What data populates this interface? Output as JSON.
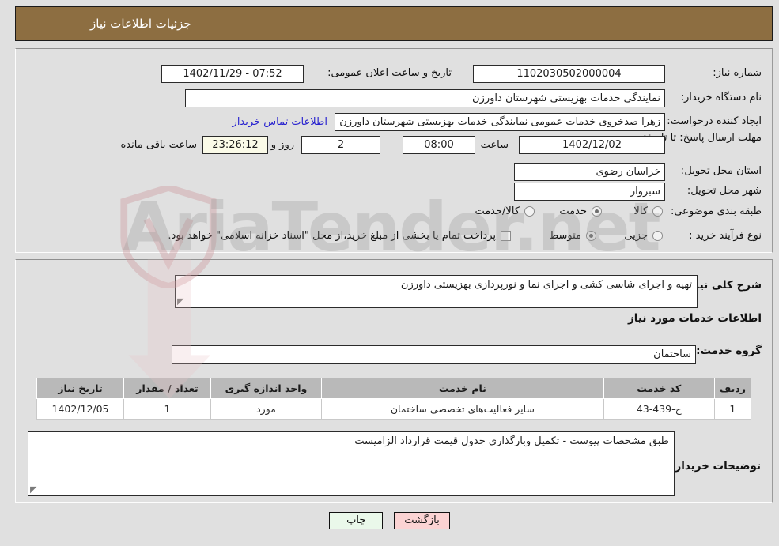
{
  "header": {
    "title": "جزئیات اطلاعات نیاز",
    "bar_color": "#8d6e41"
  },
  "top_form": {
    "need_number_label": "شماره نیاز:",
    "need_number_value": "1102030502000004",
    "public_announce_label": "تاریخ و ساعت اعلان عمومی:",
    "public_announce_value": "07:52 - 1402/11/29",
    "buyer_org_label": "نام دستگاه خریدار:",
    "buyer_org_value": "نمایندگی خدمات بهزیستی شهرستان داورزن",
    "creator_label": "ایجاد کننده درخواست:",
    "creator_value": "زهرا صدخروی خدمات عمومی نمایندگی خدمات بهزیستی شهرستان داورزن",
    "contact_link": "اطلاعات تماس خریدار",
    "deadline_label": "مهلت ارسال پاسخ: تا تاریخ:",
    "deadline_date": "1402/12/02",
    "hour_label": "ساعت",
    "hour_value": "08:00",
    "days_value": "2",
    "days_label": "روز و",
    "countdown_value": "23:26:12",
    "countdown_label": "ساعت باقی مانده",
    "province_label": "استان محل تحویل:",
    "province_value": "خراسان رضوی",
    "city_label": "شهر محل تحویل:",
    "city_value": "سبزوار",
    "category_label": "طبقه بندی موضوعی:",
    "category_options": [
      {
        "label": "کالا",
        "selected": false
      },
      {
        "label": "خدمت",
        "selected": true
      },
      {
        "label": "کالا/خدمت",
        "selected": false
      }
    ],
    "purchase_type_label": "نوع فرآیند خرید :",
    "purchase_type_options": [
      {
        "label": "جزیی",
        "selected": false
      },
      {
        "label": "متوسط",
        "selected": true
      }
    ],
    "islamic_treasury_note": "پرداخت تمام یا بخشی از مبلغ خرید،از محل \"اسناد خزانه اسلامی\" خواهد بود."
  },
  "general": {
    "desc_label": "شرح کلی نیاز:",
    "desc_value": "تهیه و اجرای شاسی کشی و اجرای نما و نورپردازی بهزیستی داورزن",
    "services_section_title": "اطلاعات خدمات مورد نیاز",
    "service_group_label": "گروه خدمت:",
    "service_group_value": "ساختمان"
  },
  "table": {
    "columns": [
      "ردیف",
      "کد خدمت",
      "نام خدمت",
      "واحد اندازه گیری",
      "تعداد / مقدار",
      "تاریخ نیاز"
    ],
    "rows": [
      {
        "index": "1",
        "code": "ج-439-43",
        "name": "سایر فعالیت‌های تخصصی ساختمان",
        "unit": "مورد",
        "qty": "1",
        "date": "1402/12/05"
      }
    ]
  },
  "buyer_notes": {
    "label": "توضیحات خریدار:",
    "value": "طبق مشخصات پیوست - تکمیل وبارگذاری  جدول قیمت  قرارداد الزامیست"
  },
  "buttons": {
    "print": "چاپ",
    "back": "بازگشت"
  },
  "watermark": {
    "text": "AriaTender.net"
  }
}
